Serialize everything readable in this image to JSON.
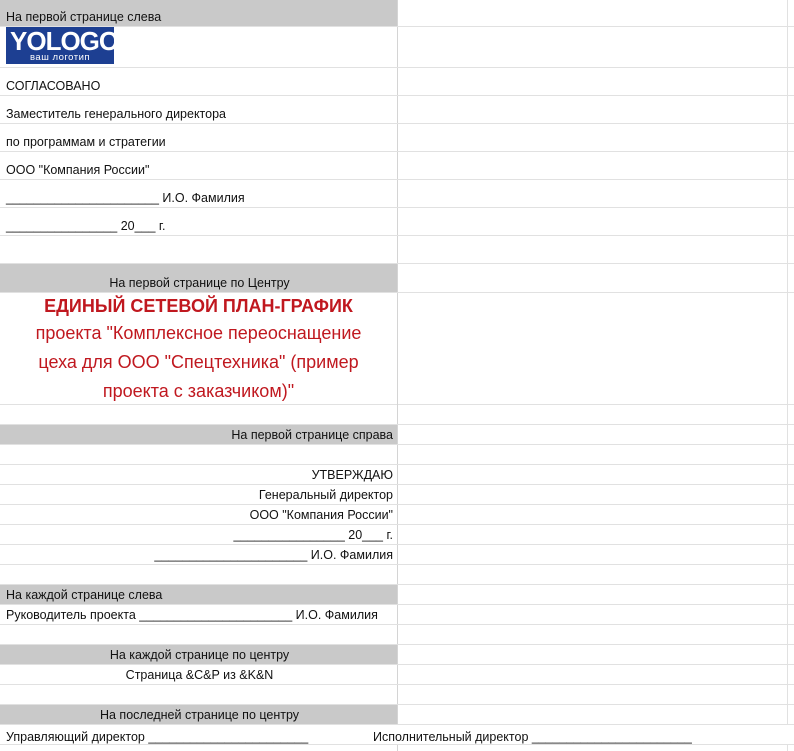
{
  "sheet": {
    "row_first_left_header": "На первой странице слева",
    "logo": {
      "big": "YOLOGO",
      "small": "ваш логотип"
    },
    "agreed": "СОГЛАСОВАНО",
    "deputy": "Заместитель генерального директора",
    "programs": "по программам и стратегии",
    "company": "ООО \"Компания России\"",
    "sign_line": "______________________ И.О. Фамилия",
    "date_line": "________________ 20___ г.",
    "row_first_center_header": "На первой странице по Центру",
    "title_bold": "ЕДИНЫЙ СЕТЕВОЙ ПЛАН-ГРАФИК",
    "title_lines": [
      "проекта \"Комплексное переоснащение",
      "цеха для ООО \"Спецтехника\" (пример",
      "проекта с заказчиком)\""
    ],
    "row_first_right_header": "На первой странице справа",
    "approve": "УТВЕРЖДАЮ",
    "gen_director": "Генеральный директор",
    "company_right": "ООО \"Компания России\"",
    "date_right": "________________ 20___ г.",
    "sign_right": "______________________ И.О. Фамилия",
    "each_left_header": "На каждой странице  слева",
    "project_manager": "Руководитель проекта ______________________ И.О. Фамилия",
    "each_center_header": "На каждой странице по центру",
    "page_code": "Страница &C&P из &K&N",
    "last_center_header": "На последней странице по центру",
    "managing_director": "Управляющий директор _______________________",
    "executive_director": "Исполнительный директор _______________________"
  }
}
